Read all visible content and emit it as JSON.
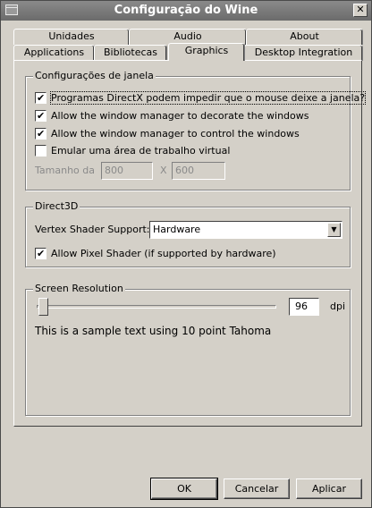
{
  "window": {
    "title": "Configuração do Wine",
    "close_glyph": "✕"
  },
  "tabs": {
    "row1": [
      "Unidades",
      "Audio",
      "About"
    ],
    "row2": [
      "Applications",
      "Bibliotecas",
      "Graphics",
      "Desktop Integration"
    ],
    "active": "Graphics"
  },
  "window_settings": {
    "title": "Configurações de janela",
    "options": [
      {
        "label": "Programas DirectX podem impedir que o mouse deixe a janela?",
        "checked": true
      },
      {
        "label": "Allow the window manager to decorate the windows",
        "checked": true
      },
      {
        "label": "Allow the window manager to control the windows",
        "checked": true
      },
      {
        "label": "Emular uma área de trabalho virtual",
        "checked": false
      }
    ],
    "size_label": "Tamanho da",
    "width_value": "800",
    "separator": "X",
    "height_value": "600"
  },
  "direct3d": {
    "title": "Direct3D",
    "vertex_shader_label": "Vertex Shader Support:",
    "vertex_shader_value": "Hardware",
    "pixel_shader_label": "Allow Pixel Shader (if supported by hardware)",
    "pixel_shader_checked": true
  },
  "screen_resolution": {
    "title": "Screen Resolution",
    "dpi_value": "96",
    "dpi_unit": "dpi",
    "sample_text": "This is a sample text using 10 point Tahoma",
    "slider_level": 0
  },
  "buttons": {
    "ok": "OK",
    "cancel": "Cancelar",
    "apply": "Aplicar"
  },
  "icons": {
    "checkmark": "check-icon",
    "dropdown": "chevron-down-icon",
    "close": "close-icon",
    "system_menu": "window-menu-icon"
  }
}
